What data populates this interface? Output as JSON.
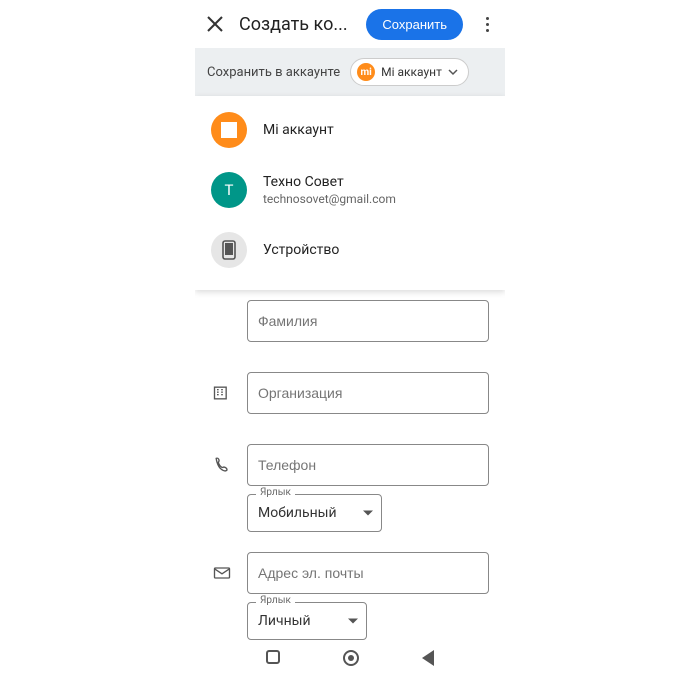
{
  "header": {
    "title": "Создать ко...",
    "save_label": "Сохранить"
  },
  "account_bar": {
    "label": "Сохранить в аккаунте",
    "chip_label": "Mi аккаунт"
  },
  "dropdown": {
    "mi_label": "Mi аккаунт",
    "google_letter": "T",
    "google_name": "Техно Совет",
    "google_email": "technosovet@gmail.com",
    "device_label": "Устройство"
  },
  "fields": {
    "lastname_placeholder": "Фамилия",
    "org_placeholder": "Организация",
    "phone_placeholder": "Телефон",
    "phone_type_label": "Ярлык",
    "phone_type_value": "Мобильный",
    "email_placeholder": "Адрес эл. почты",
    "email_type_label": "Ярлык",
    "email_type_value": "Личный"
  }
}
